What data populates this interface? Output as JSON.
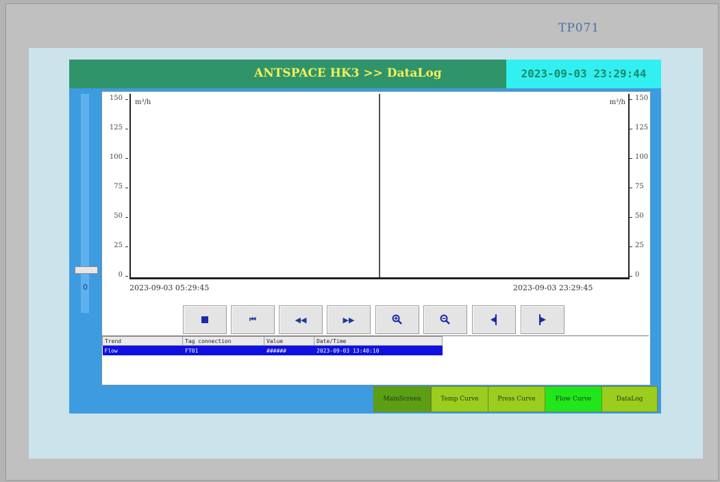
{
  "device": {
    "label": "TP071"
  },
  "header": {
    "title": "ANTSPACE HK3 >> DataLog",
    "datetime": "2023-09-03 23:29:44"
  },
  "slider": {
    "value": "0"
  },
  "chart": {
    "unit_left": "m³/h",
    "unit_right": "m³/h",
    "y_ticks": [
      "150",
      "125",
      "100",
      "75",
      "50",
      "25",
      "0"
    ],
    "time_start": "2023-09-03 05:29:45",
    "time_end": "2023-09-03 23:29:45"
  },
  "controls": [
    {
      "name": "stop-icon",
      "glyph": "stop"
    },
    {
      "name": "goto-start-icon",
      "glyph": "⏮"
    },
    {
      "name": "rewind-icon",
      "glyph": "◀◀"
    },
    {
      "name": "forward-icon",
      "glyph": "▶▶"
    },
    {
      "name": "zoom-in-icon",
      "glyph": "zoom-in"
    },
    {
      "name": "zoom-out-icon",
      "glyph": "zoom-out"
    },
    {
      "name": "ruler-left-icon",
      "glyph": "ruler-left"
    },
    {
      "name": "ruler-right-icon",
      "glyph": "ruler-right"
    }
  ],
  "table": {
    "columns": [
      "Trend",
      "Tag connection",
      "Value",
      "Date/Time"
    ],
    "rows": [
      [
        "Flow",
        "FT01",
        "######",
        "2023-09-03 13:40:10"
      ]
    ]
  },
  "nav": {
    "items": [
      {
        "label": "MainScreen",
        "color": "#5c9e14"
      },
      {
        "label": "Temp Curve",
        "color": "#9acd1e"
      },
      {
        "label": "Press Curve",
        "color": "#9acd1e"
      },
      {
        "label": "Flow Curve",
        "color": "#22e61c"
      },
      {
        "label": "DataLog",
        "color": "#9acd1e"
      }
    ]
  }
}
